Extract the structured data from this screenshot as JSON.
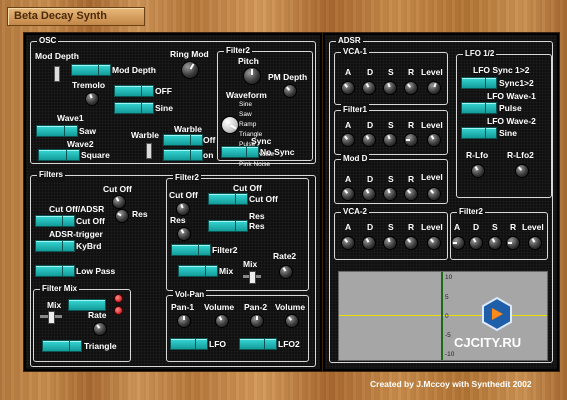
{
  "app": {
    "title": "Beta Decay Synth",
    "credit": "Created by  J.Mccoy  with Synthedit 2002",
    "watermark": "CJCITY.RU"
  },
  "osc": {
    "title": "OSC",
    "mod_depth_label": "Mod Depth",
    "mod_depth_btn": "Mod Depth",
    "ring_mod": "Ring Mod",
    "tremolo": "Tremolo",
    "tremolo_btn": "OFF",
    "sine_btn": "Sine",
    "wave1": "Wave1",
    "wave1_val": "Saw",
    "wave2": "Wave2",
    "wave2_val": "Square",
    "warble": "Warble",
    "warble_label": "Warble",
    "warble_off": "Off",
    "warble_on": "on"
  },
  "filter2_osc": {
    "title": "Filter2",
    "pitch": "Pitch",
    "pm_depth": "PM Depth",
    "waveform": "Waveform",
    "waveforms": [
      "Sine",
      "Saw",
      "Ramp",
      "Triangle",
      "Pulse",
      "White Noise",
      "Pink Noise"
    ],
    "sync": "Sync",
    "sync_val": "No-Sync"
  },
  "filters": {
    "title": "Filters",
    "cutoff": "Cut Off",
    "cutoff_adsr": "Cut Off/ADSR",
    "cutoff_btn": "Cut Off",
    "res": "Res",
    "adsr_trigger": "ADSR-trigger",
    "kybrd": "KyBrd",
    "lowpass": "Low Pass",
    "mix_title": "Filter Mix",
    "mix": "Mix",
    "rate": "Rate",
    "triangle": "Triangle"
  },
  "filter2": {
    "title": "Filter2",
    "cutoff": "Cut Off",
    "cutoff_btn1": "Cut Off",
    "cutoff_btn2": "Cut Off",
    "res": "Res",
    "res_btn1": "Res",
    "res_btn2": "Res",
    "filter2_btn": "Filter2",
    "mix_btn": "Mix",
    "mix": "Mix",
    "rate2": "Rate2"
  },
  "volpan": {
    "title": "Vol-Pan",
    "pan1": "Pan-1",
    "volume1": "Volume",
    "pan2": "Pan-2",
    "volume2": "Volume",
    "lfo": "LFO",
    "lfo2": "LFO2"
  },
  "adsr": {
    "title": "ADSR",
    "vca1": "VCA-1",
    "filter1": "Filter1",
    "modd": "Mod D",
    "vca2": "VCA-2",
    "filter2": "Filter2",
    "letters": [
      "A",
      "D",
      "S",
      "R",
      "Level"
    ]
  },
  "lfo": {
    "title": "LFO 1/2",
    "sync_label": "LFO Sync 1>2",
    "sync_val": "Sync1>2",
    "wave1_label": "LFO Wave-1",
    "wave1_val": "Pulse",
    "wave2_label": "LFO Wave-2",
    "wave2_val": "Sine",
    "rlfo": "R-Lfo",
    "rlfo2": "R-Lfo2"
  },
  "scope": {
    "ticks": [
      "10",
      "5",
      "0",
      "-5",
      "-10"
    ]
  }
}
